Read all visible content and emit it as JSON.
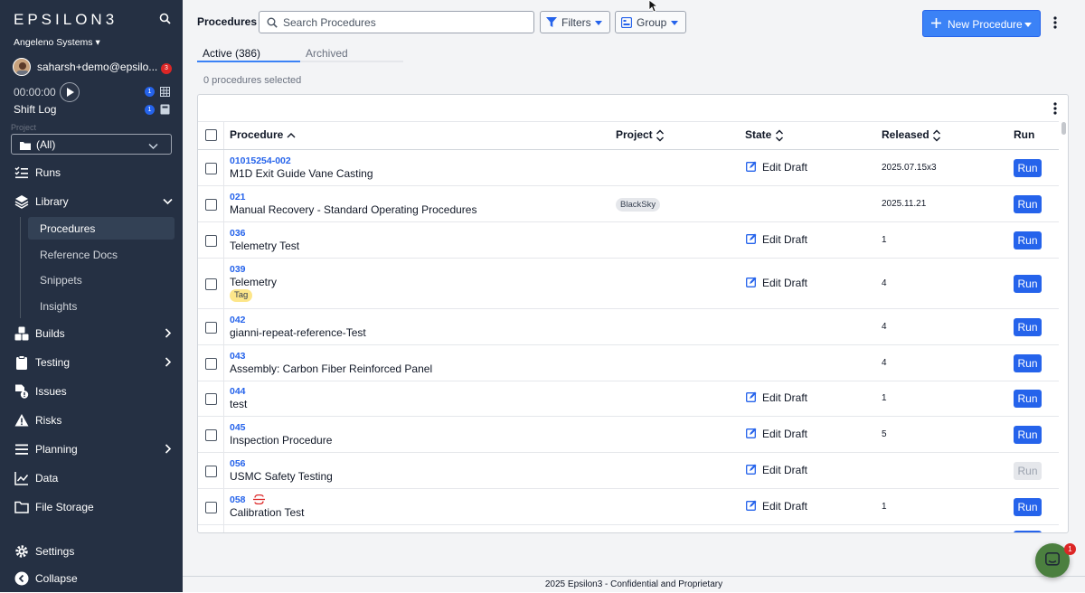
{
  "app": {
    "logo": "EPSILON3",
    "org": "Angeleno Systems",
    "user": "saharsh+demo@epsilo...",
    "notif_count": "3",
    "timer": "00:00:00",
    "shift_log": "Shift Log",
    "project_label": "Project",
    "project_value": "(All)",
    "timer_badge": "1",
    "shift_badge": "1"
  },
  "nav": {
    "runs": "Runs",
    "library": "Library",
    "procedures": "Procedures",
    "reference_docs": "Reference Docs",
    "snippets": "Snippets",
    "insights": "Insights",
    "builds": "Builds",
    "testing": "Testing",
    "issues": "Issues",
    "risks": "Risks",
    "planning": "Planning",
    "data": "Data",
    "file_storage": "File Storage",
    "settings": "Settings",
    "collapse": "Collapse"
  },
  "toolbar": {
    "title": "Procedures",
    "search_placeholder": "Search Procedures",
    "filters": "Filters",
    "group": "Group",
    "new_procedure": "New Procedure"
  },
  "tabs": {
    "active": "Active (386)",
    "archived": "Archived"
  },
  "selection_text": "0 procedures selected",
  "table": {
    "headers": {
      "procedure": "Procedure",
      "project": "Project",
      "state": "State",
      "released": "Released",
      "run": "Run"
    },
    "rows": [
      {
        "id": "01015254-002",
        "name": "M1D Exit Guide Vane Casting",
        "project": "",
        "tag": "",
        "state": "Edit Draft",
        "released": "2025.07.15x3",
        "run": "Run",
        "run_enabled": true
      },
      {
        "id": "021",
        "name": "Manual Recovery - Standard Operating Procedures",
        "project": "BlackSky",
        "tag": "",
        "state": "",
        "released": "2025.11.21",
        "run": "Run",
        "run_enabled": true
      },
      {
        "id": "036",
        "name": "Telemetry Test",
        "project": "",
        "tag": "",
        "state": "Edit Draft",
        "released": "1",
        "run": "Run",
        "run_enabled": true
      },
      {
        "id": "039",
        "name": "Telemetry",
        "project": "",
        "tag": "Tag",
        "state": "Edit Draft",
        "released": "4",
        "run": "Run",
        "run_enabled": true
      },
      {
        "id": "042",
        "name": "gianni-repeat-reference-Test",
        "project": "",
        "tag": "",
        "state": "",
        "released": "4",
        "run": "Run",
        "run_enabled": true
      },
      {
        "id": "043",
        "name": "Assembly: Carbon Fiber Reinforced Panel",
        "project": "",
        "tag": "",
        "state": "",
        "released": "4",
        "run": "Run",
        "run_enabled": true
      },
      {
        "id": "044",
        "name": "test",
        "project": "",
        "tag": "",
        "state": "Edit Draft",
        "released": "1",
        "run": "Run",
        "run_enabled": true
      },
      {
        "id": "045",
        "name": "Inspection Procedure",
        "project": "",
        "tag": "",
        "state": "Edit Draft",
        "released": "5",
        "run": "Run",
        "run_enabled": true
      },
      {
        "id": "056",
        "name": "USMC Safety Testing",
        "project": "",
        "tag": "",
        "state": "Edit Draft",
        "released": "",
        "run": "Run",
        "run_enabled": false
      },
      {
        "id": "058",
        "name": "Calibration Test",
        "project": "",
        "tag": "",
        "state": "Edit Draft",
        "released": "1",
        "run": "Run",
        "run_enabled": true
      }
    ]
  },
  "footer": "2025 Epsilon3 - Confidential and Proprietary",
  "chat_badge": "1"
}
